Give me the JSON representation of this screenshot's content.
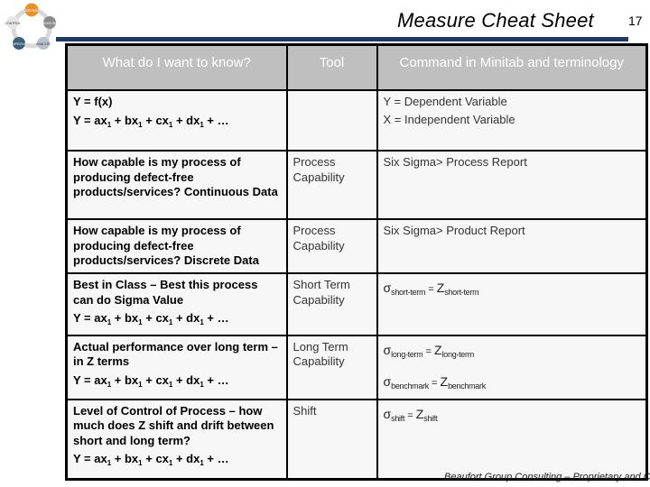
{
  "logo": {
    "labels": [
      "DEFINE",
      "MEASURE",
      "ANALYZE",
      "IMPROVE",
      "CONTROL"
    ],
    "colors": {
      "define": "#e8912a",
      "measure": "#8c8c8c",
      "analyze": "#b0b8c4",
      "improve": "#3f5f7a",
      "control": "#cfcfcf"
    }
  },
  "header": {
    "title": "Measure Cheat Sheet",
    "slide_number": "17",
    "rule_color": "#1f3864"
  },
  "table": {
    "columns": [
      "What do I want to know?",
      "Tool",
      "Command in Minitab and terminology"
    ],
    "rows": [
      {
        "question_lines": [
          "Y = f(x)"
        ],
        "equation": "Y = ax1 + bx1 + cx1 + dx1 + …",
        "tool": "",
        "command_lines": [
          "Y = Dependent Variable",
          "X = Independent Variable"
        ]
      },
      {
        "question_lines": [
          "How capable is my process of producing defect-free products/services? Continuous Data"
        ],
        "tool": "Process Capability",
        "command_lines": [
          "Six Sigma> Process Report"
        ]
      },
      {
        "question_lines": [
          "How capable is my process of producing defect-free products/services? Discrete Data"
        ],
        "tool": "Process Capability",
        "command_lines": [
          "Six Sigma> Product Report"
        ]
      },
      {
        "question_lines": [
          "Best in Class – Best this process can do Sigma Value"
        ],
        "equation": "Y = ax1 + bx1 + cx1 + dx1 + …",
        "tool": "Short Term Capability",
        "formulas": [
          {
            "left": "short-term",
            "right": "short-term"
          }
        ]
      },
      {
        "question_lines": [
          "Actual performance over long term – in Z terms"
        ],
        "equation": "Y = ax1 + bx1 + cx1 + dx1 + …",
        "tool": "Long Term Capability",
        "formulas": [
          {
            "left": "long-term",
            "right": "long-term"
          },
          {
            "left": "benchmark",
            "right": "benchmark"
          }
        ]
      },
      {
        "question_lines": [
          "Level of Control of Process – how much does Z shift and drift between short and long term?"
        ],
        "equation": "Y = ax1 + bx1 + cx1 + dx1 + …",
        "tool": "Shift",
        "formulas": [
          {
            "left": "shift",
            "right": "shift"
          }
        ]
      }
    ],
    "equation_parts": {
      "y": "Y = ",
      "terms": [
        "ax",
        "bx",
        "cx",
        "dx"
      ],
      "sub": "1",
      "plus": " + ",
      "ellipsis": "…"
    },
    "symbols": {
      "sigma": "σ",
      "z": "Z",
      "equals": " = "
    },
    "header_bg": "#bfbfbf",
    "cell_bg": "#f7f7f7"
  },
  "footer": {
    "text": "Beaufort Group Consulting – Proprietary and Confidential"
  }
}
